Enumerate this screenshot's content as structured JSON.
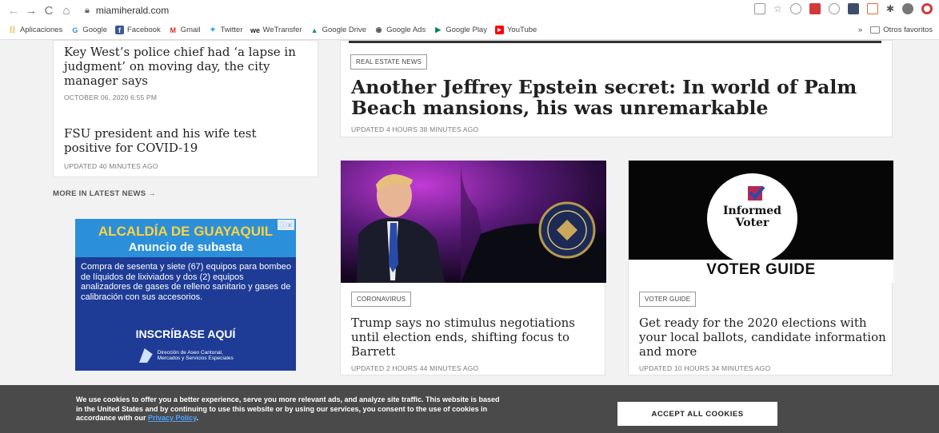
{
  "browser": {
    "url": "miamiherald.com"
  },
  "bookmarks": {
    "items": [
      {
        "label": "Aplicaciones",
        "icon": "apps-grid-icon",
        "color": "#e8a317"
      },
      {
        "label": "Google",
        "icon": "google-icon",
        "color": "#4285f4"
      },
      {
        "label": "Facebook",
        "icon": "facebook-icon",
        "color": "#3b5998"
      },
      {
        "label": "Gmail",
        "icon": "gmail-icon",
        "color": "#d93025"
      },
      {
        "label": "Twitter",
        "icon": "twitter-icon",
        "color": "#1da1f2"
      },
      {
        "label": "WeTransfer",
        "icon": "wetransfer-icon",
        "color": "#222222"
      },
      {
        "label": "Google Drive",
        "icon": "google-drive-icon",
        "color": "#0f9d58"
      },
      {
        "label": "Google Ads",
        "icon": "google-ads-icon",
        "color": "#555555"
      },
      {
        "label": "Google Play",
        "icon": "google-play-icon",
        "color": "#01875f"
      },
      {
        "label": "YouTube",
        "icon": "youtube-icon",
        "color": "#ff0000"
      }
    ],
    "overflow": "»",
    "other_favorites": "Otros favoritos"
  },
  "left_list": {
    "story1": {
      "title": "Key West’s police chief had ‘a lapse in judgment’ on moving day, the city manager says",
      "meta": "OCTOBER 06, 2020 6:55 PM"
    },
    "story2": {
      "title": "FSU president and his wife test positive for COVID-19",
      "meta": "UPDATED 40 MINUTES AGO"
    },
    "more_link": "MORE IN LATEST NEWS →"
  },
  "ad": {
    "title": "ALCALDÍA DE GUAYAQUIL",
    "subtitle": "Anuncio de subasta",
    "body": "Compra de sesenta y siete (67) equipos para bombeo de líquidos de lixiviados y dos (2) equipos analizadores de gases de relleno sanitario y gases de calibración con sus accesorios.",
    "cta": "INSCRÍBASE AQUÍ",
    "logo_text": "Dirección de Aseo Cantonal, Mercados y Servicios Especiales",
    "close": "ⓘ✕"
  },
  "featured": {
    "tag": "REAL ESTATE NEWS",
    "title": "Another Jeffrey Epstein secret: In world of Palm Beach mansions, his was unremarkable",
    "meta": "UPDATED 4 HOURS 38 MINUTES AGO"
  },
  "card_trump": {
    "tag": "CORONAVIRUS",
    "title": "Trump says no stimulus negotiations until election ends, shifting focus to Barrett",
    "meta": "UPDATED 2 HOURS 44 MINUTES AGO"
  },
  "card_voter": {
    "image_logo_line1": "Informed",
    "image_logo_line2": "Voter",
    "image_caption": "VOTER GUIDE",
    "tag": "VOTER GUIDE",
    "title": "Get ready for the 2020 elections with your local ballots, candidate information and more",
    "meta": "UPDATED 10 HOURS 34 MINUTES AGO"
  },
  "cookie": {
    "text": "We use cookies to offer you a better experience, serve you more relevant ads, and analyze site traffic. This website is based in the United States and by continuing to use this website or by using our services, you consent to the use of cookies in accordance with our ",
    "link": "Privacy Policy",
    "suffix": ".",
    "button": "ACCEPT ALL COOKIES"
  }
}
